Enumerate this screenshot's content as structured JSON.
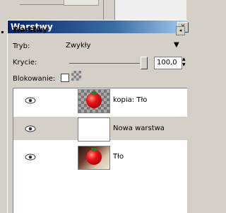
{
  "window": {
    "title": "Warstwy",
    "close_label": "x"
  },
  "dock": {
    "title": "Warstwy",
    "menu_icon": "triangle-left-icon"
  },
  "mode": {
    "label": "Tryb:",
    "value": "Zwykły"
  },
  "opacity": {
    "label": "Krycie:",
    "value": "100,0",
    "fraction": 1.0
  },
  "lock": {
    "label": "Blokowanie:",
    "checked": false
  },
  "layers": [
    {
      "name": "kopia: Tło",
      "visible": true,
      "selected": false,
      "thumb": "tomato-on-transparent"
    },
    {
      "name": "Nowa warstwa",
      "visible": true,
      "selected": true,
      "thumb": "blank-white"
    },
    {
      "name": "Tło",
      "visible": true,
      "selected": false,
      "thumb": "tomato-photo"
    }
  ],
  "colors": {
    "titlebar": "#0a246a",
    "selected_row": "#d4d0c8",
    "panel_bg": "#d4d0c8"
  }
}
